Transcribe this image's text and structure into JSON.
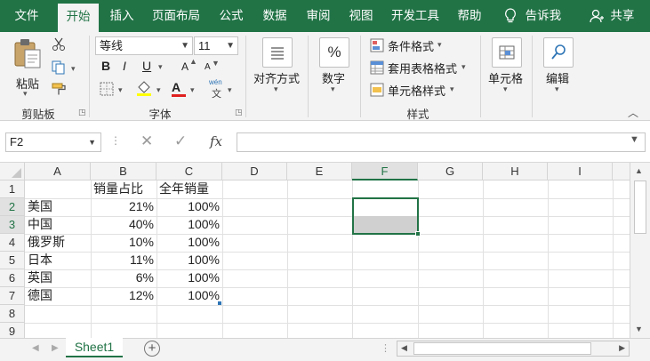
{
  "menu": {
    "tabs": [
      "文件",
      "开始",
      "插入",
      "页面布局",
      "公式",
      "数据",
      "审阅",
      "视图",
      "开发工具",
      "帮助"
    ],
    "active_tab": "开始",
    "tell_me": "告诉我",
    "share": "共享"
  },
  "ribbon": {
    "clipboard": {
      "paste": "粘贴",
      "label": "剪贴板"
    },
    "font": {
      "name": "等线",
      "size": "11",
      "label": "字体",
      "bold": "B",
      "italic": "I",
      "underline": "U",
      "grow": "A",
      "shrink": "A",
      "phonetic_top": "wén",
      "phonetic_char": "文",
      "font_color_letter": "A"
    },
    "alignment": {
      "label": "对齐方式"
    },
    "number": {
      "label": "数字",
      "icon": "%"
    },
    "styles": {
      "conditional": "条件格式",
      "table": "套用表格格式",
      "cell": "单元格样式",
      "label": "样式"
    },
    "cells": {
      "label": "单元格"
    },
    "editing": {
      "label": "编辑"
    }
  },
  "formula_bar": {
    "name_box": "F2",
    "fx": "fx",
    "value": ""
  },
  "sheet": {
    "columns": [
      "A",
      "B",
      "C",
      "D",
      "E",
      "F",
      "G",
      "H",
      "I"
    ],
    "rows": [
      "1",
      "2",
      "3",
      "4",
      "5",
      "6",
      "7",
      "8",
      "9"
    ],
    "selected_column": "F",
    "header": {
      "A": "",
      "B": "销量占比",
      "C": "全年销量"
    },
    "data": [
      {
        "country": "美国",
        "share": "21%",
        "total": "100%"
      },
      {
        "country": "中国",
        "share": "40%",
        "total": "100%"
      },
      {
        "country": "俄罗斯",
        "share": "10%",
        "total": "100%"
      },
      {
        "country": "日本",
        "share": "11%",
        "total": "100%"
      },
      {
        "country": "英国",
        "share": "6%",
        "total": "100%"
      },
      {
        "country": "德国",
        "share": "12%",
        "total": "100%"
      }
    ],
    "tab_name": "Sheet1"
  },
  "colors": {
    "brand": "#217346",
    "selection_fill": "#d0d0d0"
  }
}
